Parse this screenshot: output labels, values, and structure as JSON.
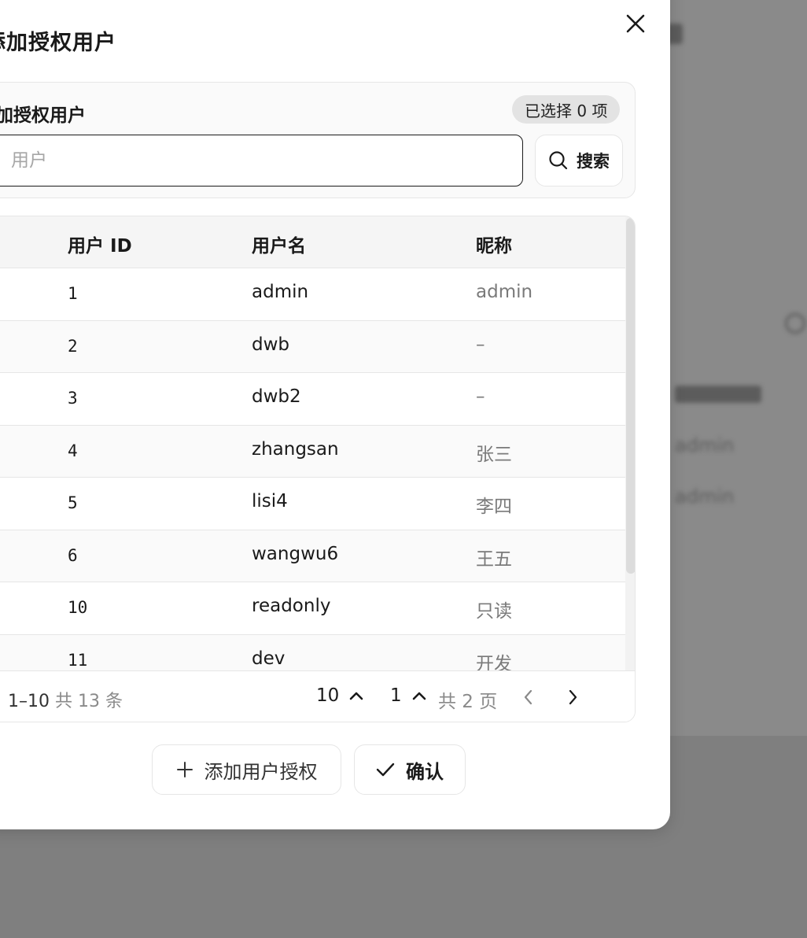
{
  "background": {
    "row1": "admin",
    "row2": "admin"
  },
  "modal": {
    "title": "添加授权用户"
  },
  "search": {
    "card_title": "添加授权用户",
    "selected_badge": "已选择 0 项",
    "placeholder": "用户",
    "button_label": "搜索"
  },
  "table": {
    "headers": {
      "user_id": "用户 ID",
      "username": "用户名",
      "nickname": "昵称"
    },
    "rows": [
      {
        "id": "1",
        "username": "admin",
        "nickname": "admin"
      },
      {
        "id": "2",
        "username": "dwb",
        "nickname": "–"
      },
      {
        "id": "3",
        "username": "dwb2",
        "nickname": "–"
      },
      {
        "id": "4",
        "username": "zhangsan",
        "nickname": "张三"
      },
      {
        "id": "5",
        "username": "lisi4",
        "nickname": "李四"
      },
      {
        "id": "6",
        "username": "wangwu6",
        "nickname": "王五"
      },
      {
        "id": "10",
        "username": "readonly",
        "nickname": "只读"
      },
      {
        "id": "11",
        "username": "dev",
        "nickname": "开发"
      }
    ]
  },
  "pagination": {
    "range": "1–10",
    "total_label": "共 13 条",
    "page_size": "10",
    "current_page": "1",
    "pages_label": "共 2 页"
  },
  "footer": {
    "add_label": "添加用户授权",
    "confirm_label": "确认"
  },
  "icons": {
    "close": "close-icon",
    "search": "search-icon",
    "chevron_up": "chevron-up-icon",
    "prev": "chevron-left-icon",
    "next": "chevron-right-icon",
    "plus": "plus-icon",
    "check": "check-icon"
  }
}
